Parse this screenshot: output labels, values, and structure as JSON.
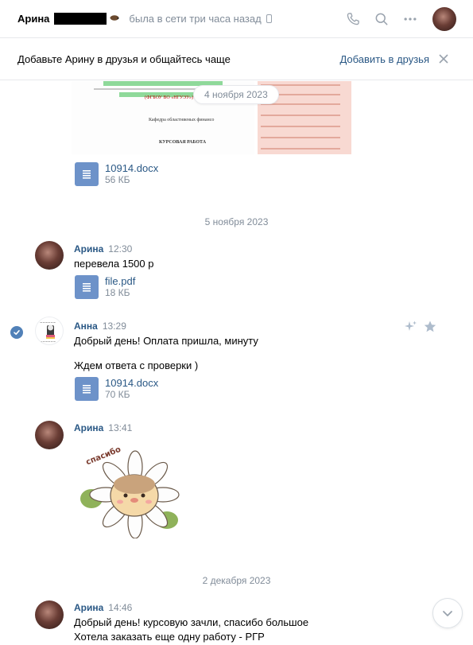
{
  "header": {
    "name": "Арина",
    "status": "была в сети три часа назад"
  },
  "banner": {
    "text": "Добавьте Арину в друзья и общайтесь чаще",
    "add_label": "Добавить в друзья"
  },
  "chat": {
    "floating_date": "4 ноября 2023",
    "first_file": {
      "name": "10914.docx",
      "size": "56 КБ"
    },
    "date_separators": [
      "5 ноября 2023",
      "2 декабря 2023"
    ],
    "messages": [
      {
        "author": "Арина",
        "time": "12:30",
        "text": "перевела 1500 р",
        "file": {
          "name": "file.pdf",
          "size": "18 КБ"
        }
      },
      {
        "author": "Анна",
        "time": "13:29",
        "text1": "Добрый день! Оплата пришла, минуту",
        "text2": "Ждем ответа с проверки )",
        "file": {
          "name": "10914.docx",
          "size": "70 КБ"
        }
      },
      {
        "author": "Арина",
        "time": "13:41",
        "sticker_text": "спасибо"
      },
      {
        "author": "Арина",
        "time": "14:46",
        "text1": "Добрый день! курсовую зачли, спасибо большое",
        "text2": "Хотела заказать еще одну работу - РГР"
      }
    ],
    "doc_preview": {
      "line1": "(ФГБОУ ВО «НГУЭУ»)",
      "line2": "Кафедра областнвеных финансо",
      "line3": "КУРСОВАЯ РАБОТА"
    }
  },
  "colors": {
    "link": "#2a5885",
    "muted": "#818c99",
    "file_icon": "#6d92c9",
    "accent": "#5181b8"
  }
}
